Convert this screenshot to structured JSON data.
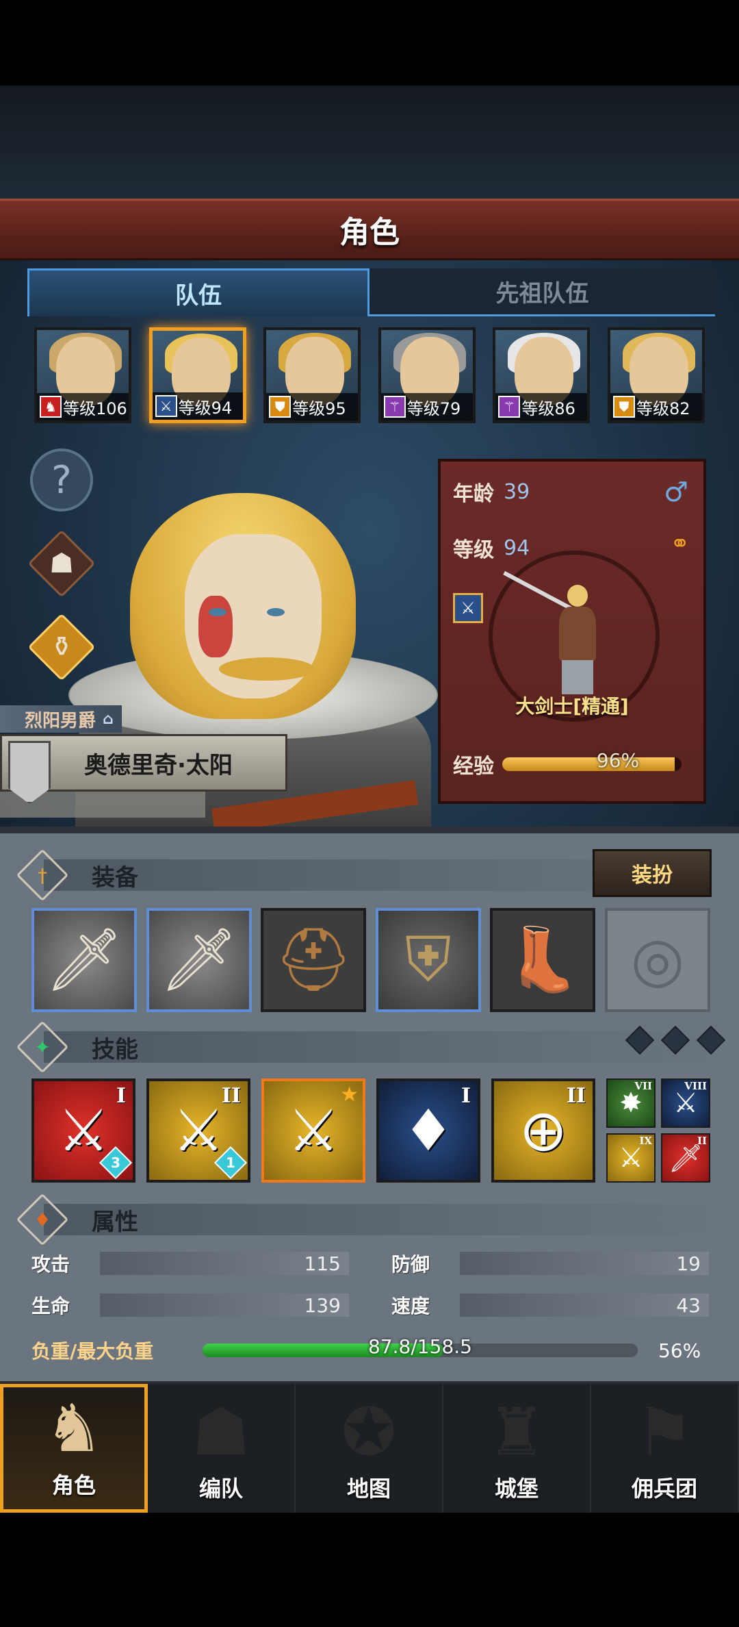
{
  "screen_title": "角色",
  "tabs": [
    {
      "label": "队伍",
      "active": true
    },
    {
      "label": "先祖队伍",
      "active": false
    }
  ],
  "party": [
    {
      "level_text": "等级106",
      "class_icon": "horse-icon",
      "hair_color": "#c9a86a"
    },
    {
      "level_text": "等级94",
      "class_icon": "sword-star-icon",
      "hair_color": "#e8c35a",
      "selected": true
    },
    {
      "level_text": "等级95",
      "class_icon": "shield-star-icon",
      "hair_color": "#d8a840"
    },
    {
      "level_text": "等级79",
      "class_icon": "staff-icon",
      "hair_color": "#9a9a9a"
    },
    {
      "level_text": "等级86",
      "class_icon": "staff-icon",
      "hair_color": "#e6e6e6"
    },
    {
      "level_text": "等级82",
      "class_icon": "shield-star-icon",
      "hair_color": "#e0b85a"
    }
  ],
  "side_icons": [
    "help-icon",
    "helmet-icon",
    "potion-icon"
  ],
  "hero": {
    "title": "烈阳男爵",
    "name": "奥德里奇·太阳"
  },
  "info": {
    "age_label": "年龄",
    "age_value": "39",
    "level_label": "等级",
    "level_value": "94",
    "gender_symbol": "♂",
    "class_name": "大剑士[精通]",
    "exp_label": "经验",
    "exp_percent": 96,
    "exp_text": "96%"
  },
  "equipment": {
    "section_title": "装备",
    "dress_button": "装扮",
    "slots": [
      {
        "type": "weapon",
        "icon": "greatsword-icon",
        "rare": true
      },
      {
        "type": "weapon",
        "icon": "greatsword-icon",
        "rare": true
      },
      {
        "type": "helm",
        "icon": "helmet-icon",
        "rare": false
      },
      {
        "type": "armor",
        "icon": "armor-icon",
        "rare": true
      },
      {
        "type": "boots",
        "icon": "boots-icon",
        "rare": false
      },
      {
        "type": "ring",
        "icon": "ring-icon",
        "empty": true
      }
    ]
  },
  "skills": {
    "section_title": "技能",
    "items": [
      {
        "color": "red",
        "roman": "I",
        "gem": "3"
      },
      {
        "color": "gold",
        "roman": "II",
        "gem": "1"
      },
      {
        "color": "gold-sel",
        "star": true
      },
      {
        "color": "blue",
        "roman": "I"
      },
      {
        "color": "gold",
        "roman": "II"
      }
    ],
    "minis": [
      {
        "color": "g",
        "roman": "VII"
      },
      {
        "color": "b",
        "roman": "VIII"
      },
      {
        "color": "y",
        "roman": "IX"
      },
      {
        "color": "rd",
        "roman": "II"
      }
    ]
  },
  "attributes": {
    "section_title": "属性",
    "attack_label": "攻击",
    "attack_value": "115",
    "defense_label": "防御",
    "defense_value": "19",
    "hp_label": "生命",
    "hp_value": "139",
    "speed_label": "速度",
    "speed_value": "43",
    "load_label": "负重/最大负重",
    "load_text": "87.8/158.5",
    "load_fraction": 0.554,
    "load_percent": "56%"
  },
  "nav": [
    {
      "label": "角色",
      "icon": "knight-icon",
      "active": true
    },
    {
      "label": "编队",
      "icon": "helmet-group-icon"
    },
    {
      "label": "地图",
      "icon": "compass-map-icon"
    },
    {
      "label": "城堡",
      "icon": "castle-icon"
    },
    {
      "label": "佣兵团",
      "icon": "banner-ship-icon"
    }
  ]
}
